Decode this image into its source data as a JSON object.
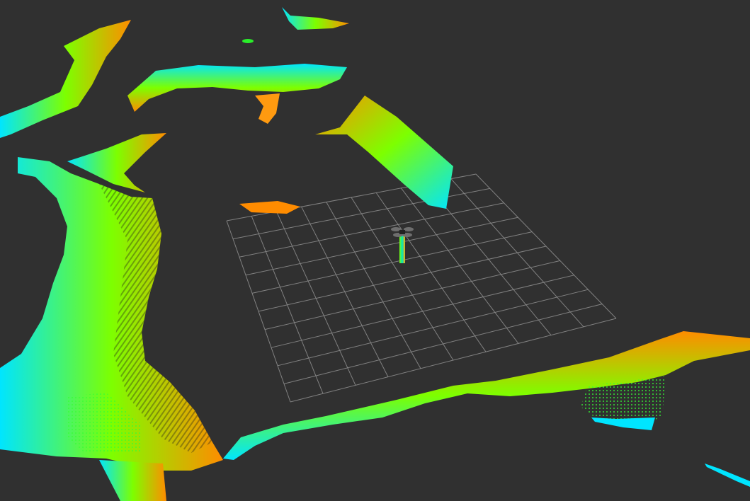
{
  "viewport": {
    "background": "#303030",
    "grid_color": "#8a8a8a",
    "grid_cells": 10
  },
  "colormap": {
    "low": "#00e5ff",
    "mid": "#7dff00",
    "high": "#ff8c00"
  },
  "robot": {
    "icon": "quadrotor-icon",
    "body_color": "#222222",
    "rotor_color": "#6e6e6e"
  }
}
